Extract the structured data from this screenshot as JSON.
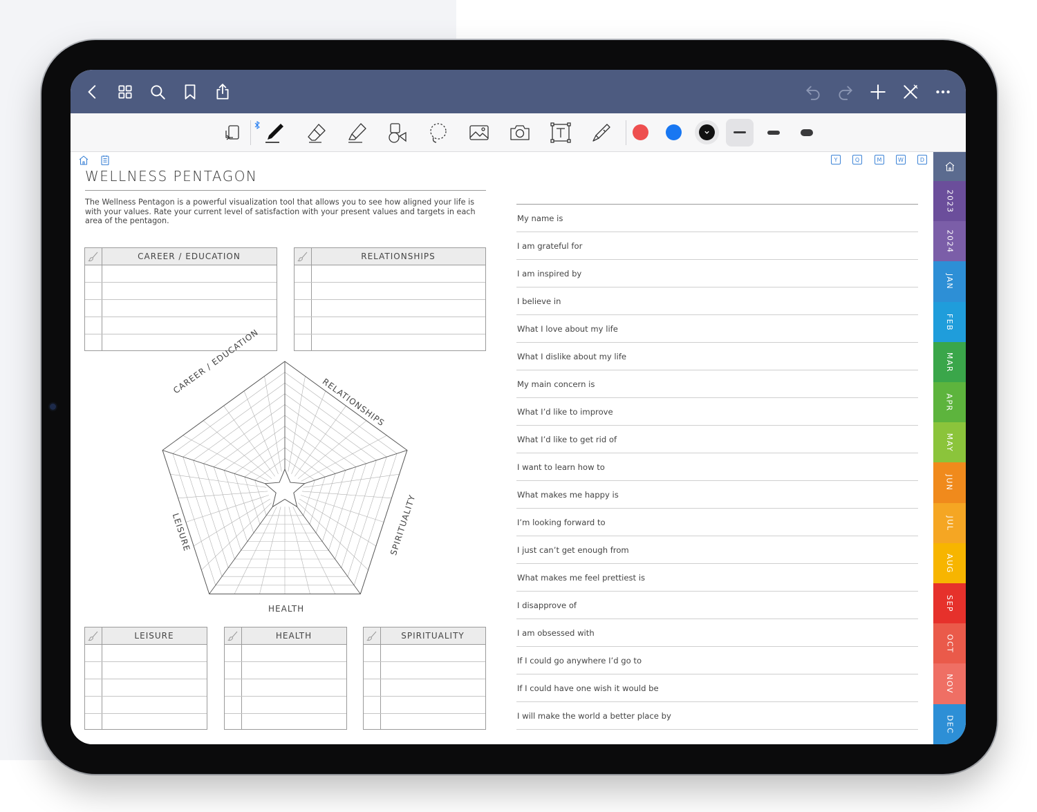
{
  "topbar": {
    "left_icons": [
      "back-icon",
      "grid-icon",
      "search-icon",
      "bookmark-icon",
      "share-icon"
    ],
    "right_icons": [
      "undo-icon",
      "redo-icon",
      "add-icon",
      "close-pen-icon",
      "more-icon"
    ]
  },
  "toolbar": {
    "tools": [
      "read-mode-icon",
      "pen-icon",
      "eraser-icon",
      "highlighter-icon",
      "shapes-icon",
      "lasso-icon",
      "image-icon",
      "camera-icon",
      "text-icon",
      "laser-icon"
    ],
    "bluetooth_icon": "bluetooth-icon",
    "colors": [
      {
        "name": "red",
        "hex": "#ee4f4f"
      },
      {
        "name": "blue",
        "hex": "#1877f2"
      },
      {
        "name": "black",
        "hex": "#111111"
      }
    ],
    "stroke_options": [
      "thin",
      "medium",
      "thick"
    ],
    "selected_stroke": "thin"
  },
  "page_nav": {
    "left_icons": [
      "home-icon",
      "notes-icon"
    ],
    "right_labels": [
      "Y",
      "Q",
      "M",
      "W",
      "D"
    ]
  },
  "page": {
    "title": "WELLNESS PENTAGON",
    "description": "The Wellness Pentagon is a powerful visualization tool that allows you to see how aligned your life is with your values. Rate your current level of satisfaction with your present values and targets in each area of the pentagon."
  },
  "categories": {
    "career": "CAREER / EDUCATION",
    "relationships": "RELATIONSHIPS",
    "leisure": "LEISURE",
    "health": "HEALTH",
    "spirituality": "SPIRITUALITY"
  },
  "pentagon_labels": {
    "career": "CAREER / EDUCATION",
    "relationships": "RELATIONSHIPS",
    "spirituality": "SPIRITUALITY",
    "health": "HEALTH",
    "leisure": "LEISURE"
  },
  "prompts": [
    "My name is",
    "I am grateful for",
    "I am inspired by",
    "I believe in",
    "What I love about my life",
    "What I dislike about my life",
    "My main concern is",
    "What I’d like to improve",
    "What I’d like to get rid of",
    "I want to learn how to",
    "What makes me happy is",
    "I’m looking forward to",
    "I just can’t get enough from",
    "What makes me feel prettiest is",
    "I disapprove of",
    "I am obsessed with",
    "If I could go anywhere I’d go to",
    "If I could have one wish it would be",
    "I will make the world a better place by"
  ],
  "side_tabs": [
    {
      "label": "2023",
      "color": "#6b4e9b"
    },
    {
      "label": "2024",
      "color": "#7b5ea8"
    },
    {
      "label": "JAN",
      "color": "#2d8fd6"
    },
    {
      "label": "FEB",
      "color": "#1f9ddb"
    },
    {
      "label": "MAR",
      "color": "#3aa64a"
    },
    {
      "label": "APR",
      "color": "#5db43d"
    },
    {
      "label": "MAY",
      "color": "#8bc43b"
    },
    {
      "label": "JUN",
      "color": "#f08a1c"
    },
    {
      "label": "JUL",
      "color": "#f5a623"
    },
    {
      "label": "AUG",
      "color": "#f7b500"
    },
    {
      "label": "SEP",
      "color": "#e6312b"
    },
    {
      "label": "OCT",
      "color": "#ea5a4a"
    },
    {
      "label": "NOV",
      "color": "#ef6f64"
    },
    {
      "label": "DEC",
      "color": "#2d8fd6"
    }
  ]
}
